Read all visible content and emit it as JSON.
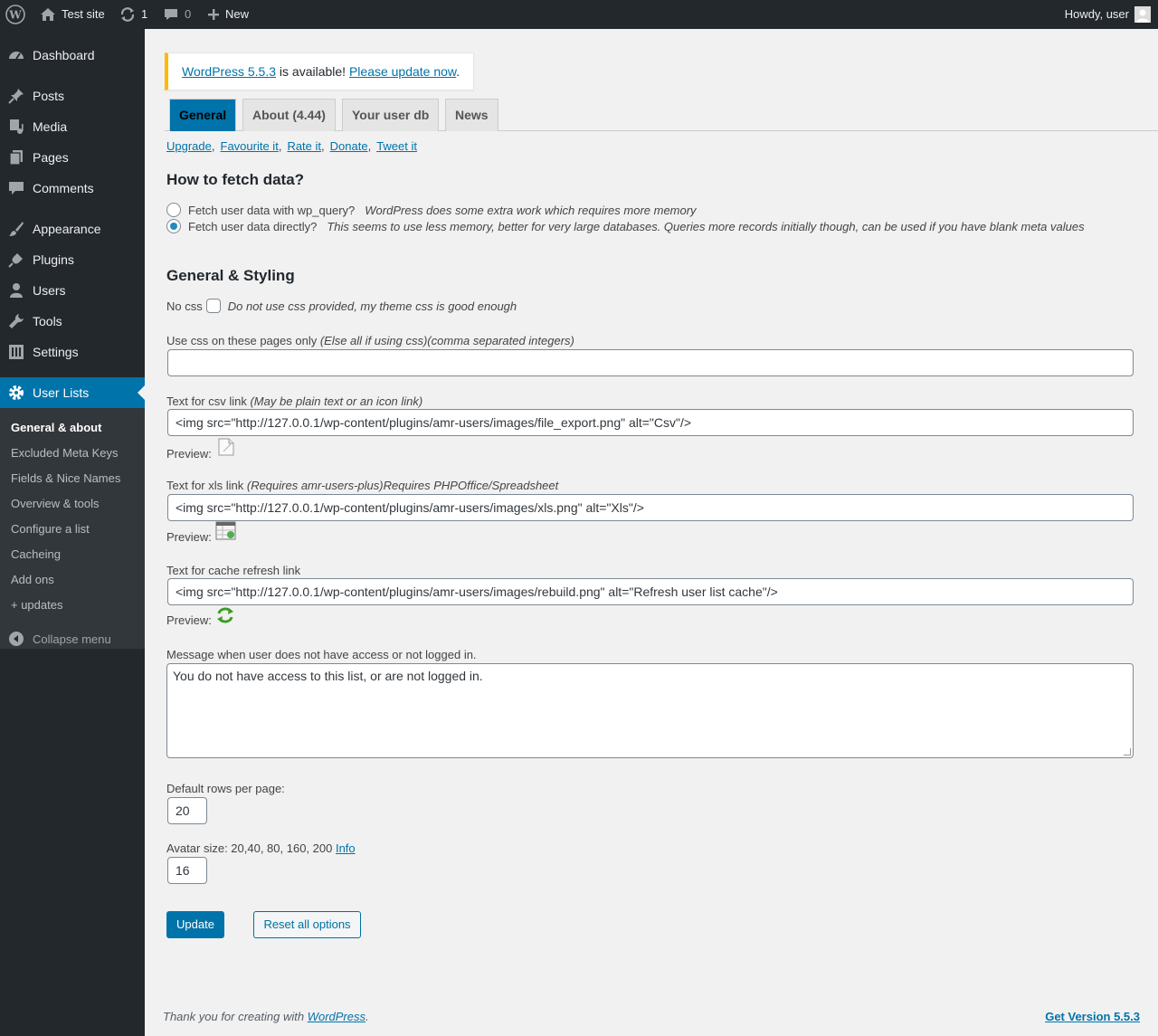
{
  "adminbar": {
    "site_name": "Test site",
    "updates_count": "1",
    "comments_count": "0",
    "new_label": "New",
    "greeting": "Howdy, user"
  },
  "menu": {
    "dashboard": "Dashboard",
    "posts": "Posts",
    "media": "Media",
    "pages": "Pages",
    "comments": "Comments",
    "appearance": "Appearance",
    "plugins": "Plugins",
    "users": "Users",
    "tools": "Tools",
    "settings": "Settings",
    "user_lists": "User Lists",
    "submenu": [
      "General & about",
      "Excluded Meta Keys",
      "Fields & Nice Names",
      "Overview & tools",
      "Configure a list",
      "Cacheing",
      "Add ons",
      "+ updates"
    ],
    "collapse": "Collapse menu"
  },
  "notice": {
    "version_link": "WordPress 5.5.3",
    "middle": " is available! ",
    "update_link": "Please update now",
    "end": "."
  },
  "tabs": [
    "General",
    "About (4.44)",
    "Your user db",
    "News"
  ],
  "links": [
    "Upgrade",
    "Favourite it",
    "Rate it",
    "Donate",
    "Tweet it"
  ],
  "fetch": {
    "heading": "How to fetch data?",
    "option1_label": "Fetch user data with wp_query?",
    "option1_note": "WordPress does some extra work which requires more memory",
    "option2_label": "Fetch user data directly?",
    "option2_note": "This seems to use less memory, better for very large databases. Queries more records initially though, can be used if you have blank meta values",
    "selected": 2
  },
  "styling": {
    "heading": "General & Styling",
    "nocss_label": "No css",
    "nocss_note": "Do not use css provided, my theme css is good enough",
    "css_pages_label": "Use css on these pages only ",
    "css_pages_note": "(Else all if using css)(comma separated integers)",
    "css_pages_value": "",
    "csv_label": "Text for csv link ",
    "csv_note": "(May be plain text or an icon link)",
    "csv_value": "<img src=\"http://127.0.0.1/wp-content/plugins/amr-users/images/file_export.png\" alt=\"Csv\"/>",
    "xls_label": "Text for xls link ",
    "xls_note": "(Requires amr-users-plus)Requires PHPOffice/Spreadsheet",
    "xls_value": "<img src=\"http://127.0.0.1/wp-content/plugins/amr-users/images/xls.png\" alt=\"Xls\"/>",
    "refresh_label": "Text for cache refresh link",
    "refresh_value": "<img src=\"http://127.0.0.1/wp-content/plugins/amr-users/images/rebuild.png\" alt=\"Refresh user list cache\"/>",
    "preview_label": "Preview:",
    "message_label": "Message when user does not have access or not logged in.",
    "message_value": "You do not have access to this list, or are not logged in.",
    "rows_label": "Default rows per page:",
    "rows_value": "20",
    "avatar_label": "Avatar size: 20,40, 80, 160, 200 ",
    "avatar_info": "Info",
    "avatar_value": "16"
  },
  "buttons": {
    "update": "Update",
    "reset": "Reset all options"
  },
  "footer": {
    "thanks": "Thank you for creating with ",
    "wp_link": "WordPress",
    "end": ".",
    "version": "Get Version 5.5.3"
  },
  "colors": {
    "adminbar_bg": "#23282d",
    "accent": "#0073aa",
    "notice_border": "#ffb900",
    "content_bg": "#f1f1f1"
  }
}
